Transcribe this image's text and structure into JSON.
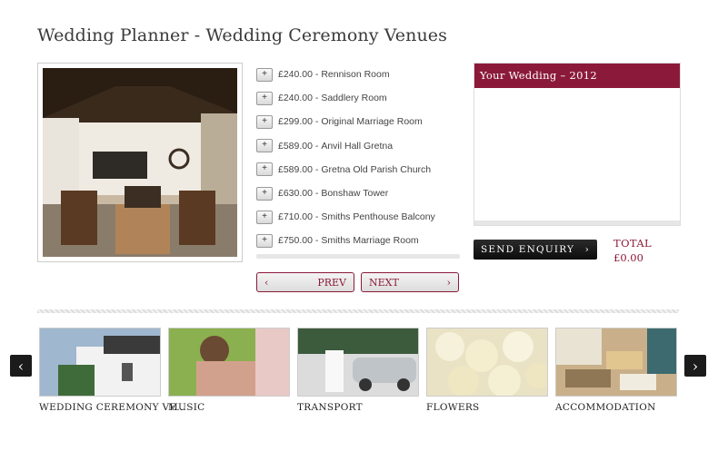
{
  "page": {
    "title": "Wedding Planner - Wedding Ceremony Venues"
  },
  "venues": [
    {
      "price": "£240.00",
      "name": "Rennison Room"
    },
    {
      "price": "£240.00",
      "name": "Saddlery Room"
    },
    {
      "price": "£299.00",
      "name": "Original Marriage Room"
    },
    {
      "price": "£589.00",
      "name": "Anvil Hall Gretna"
    },
    {
      "price": "£589.00",
      "name": "Gretna Old Parish Church"
    },
    {
      "price": "£630.00",
      "name": "Bonshaw Tower"
    },
    {
      "price": "£710.00",
      "name": "Smiths Penthouse Balcony"
    },
    {
      "price": "£750.00",
      "name": "Smiths Marriage Room"
    }
  ],
  "add_button_label": "+",
  "pager": {
    "prev": "PREV",
    "next": "NEXT"
  },
  "wedding_box": {
    "title": "Your Wedding – 2012"
  },
  "enquiry": {
    "label": "SEND ENQUIRY"
  },
  "total": {
    "label": "TOTAL",
    "value": "£0.00"
  },
  "categories": [
    {
      "label": "WEDDING CEREMONY VE..."
    },
    {
      "label": "MUSIC"
    },
    {
      "label": "TRANSPORT"
    },
    {
      "label": "FLOWERS"
    },
    {
      "label": "ACCOMMODATION"
    }
  ],
  "colors": {
    "accent": "#8b1a3a",
    "dark_button": "#111111"
  },
  "icons": {
    "add": "plus-icon",
    "prev": "chevron-left-icon",
    "next": "chevron-right-icon",
    "enquiry": "chevron-right-icon"
  }
}
